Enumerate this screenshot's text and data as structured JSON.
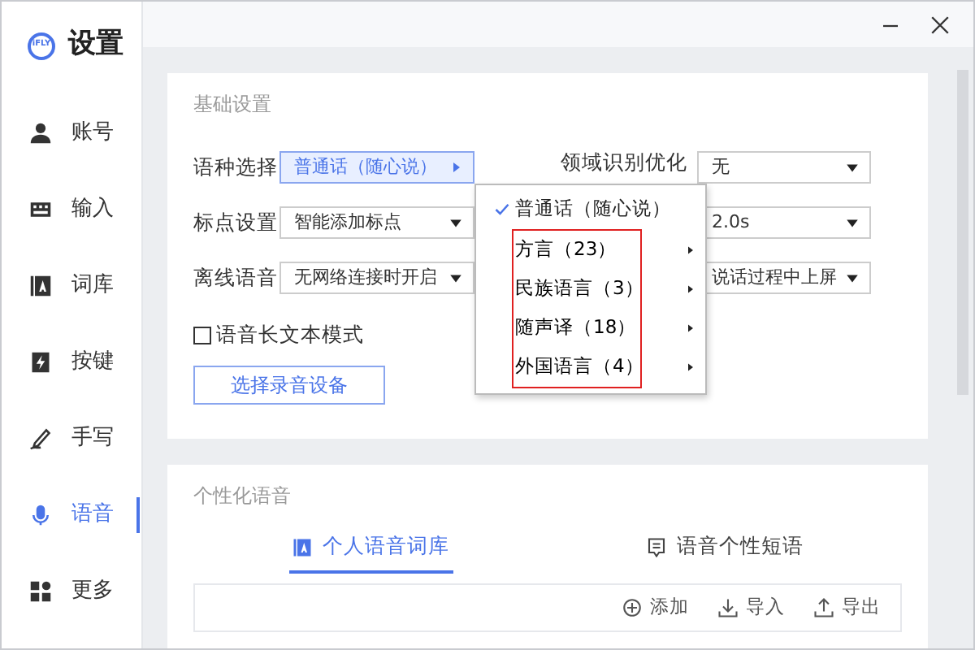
{
  "app": {
    "logo": "iFLY",
    "title": "设置"
  },
  "sidebar": {
    "items": [
      {
        "label": "账号",
        "selected": false
      },
      {
        "label": "输入",
        "selected": false
      },
      {
        "label": "词库",
        "selected": false
      },
      {
        "label": "按键",
        "selected": false
      },
      {
        "label": "手写",
        "selected": false
      },
      {
        "label": "语音",
        "selected": true
      },
      {
        "label": "更多",
        "selected": false
      }
    ]
  },
  "basic_settings": {
    "title": "基础设置",
    "rows": [
      {
        "label": "语种选择",
        "value": "普通话（随心说）",
        "kind": "submenu",
        "open": true
      },
      {
        "label": "标点设置",
        "value": "智能添加标点",
        "kind": "dropdown",
        "open": false
      },
      {
        "label": "离线语音",
        "value": "无网络连接时开启",
        "kind": "dropdown",
        "open": false
      }
    ],
    "right_rows": [
      {
        "label": "领域识别优化",
        "value": "无"
      },
      {
        "value": "2.0s"
      },
      {
        "value": "说话过程中上屏"
      }
    ],
    "checkbox": {
      "label": "语音长文本模式",
      "checked": false
    },
    "button": "选择录音设备"
  },
  "language_menu": {
    "items": [
      {
        "label": "普通话（随心说）",
        "checked": true,
        "boxed": false
      },
      {
        "label": "方言（23）",
        "checked": false,
        "boxed": true
      },
      {
        "label": "民族语言（3）",
        "checked": false,
        "boxed": true
      },
      {
        "label": "随声译（18）",
        "checked": false,
        "boxed": true
      },
      {
        "label": "外国语言（4）",
        "checked": false,
        "boxed": true
      }
    ]
  },
  "personal_voice": {
    "title": "个性化语音",
    "tabs": [
      {
        "label": "个人语音词库",
        "selected": true
      },
      {
        "label": "语音个性短语",
        "selected": false
      }
    ],
    "actions": [
      "添加",
      "导入",
      "导出"
    ]
  }
}
